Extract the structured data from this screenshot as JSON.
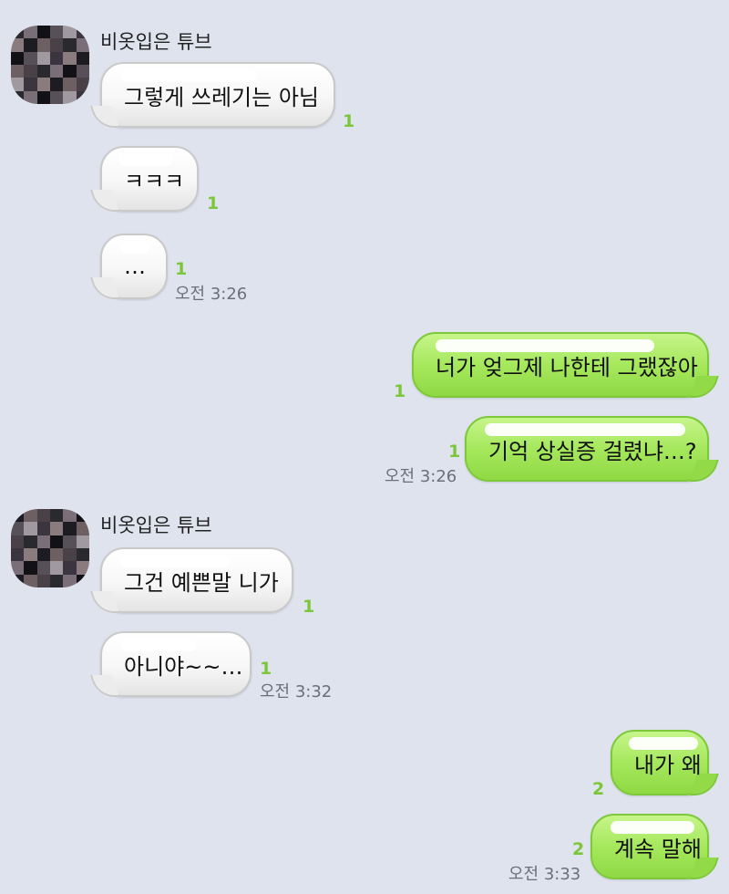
{
  "contact_name": "비옷입은 튜브",
  "messages": [
    {
      "text": "그렇게 쓰레기는 아님",
      "count": "1"
    },
    {
      "text": "ㅋㅋㅋ",
      "count": "1"
    },
    {
      "text": "…",
      "count": "1",
      "time": "오전 3:26"
    },
    {
      "text": "너가 엊그제 나한테 그랬잖아",
      "count": "1"
    },
    {
      "text": "기억 상실증 걸렸냐…?",
      "count": "1",
      "time": "오전 3:26"
    },
    {
      "text": "그건 예쁜말 니가",
      "count": "1"
    },
    {
      "text": "아니야~~…",
      "count": "1",
      "time": "오전 3:32"
    },
    {
      "text": "내가 왜",
      "count": "2"
    },
    {
      "text": "계속 말해",
      "count": "2",
      "time": "오전 3:33"
    }
  ],
  "colors": {
    "background": "#dfe3ee",
    "outgoing_bubble": "#a6e85d",
    "incoming_bubble": "#f7f7f7",
    "unread_count": "#7cc63a"
  }
}
